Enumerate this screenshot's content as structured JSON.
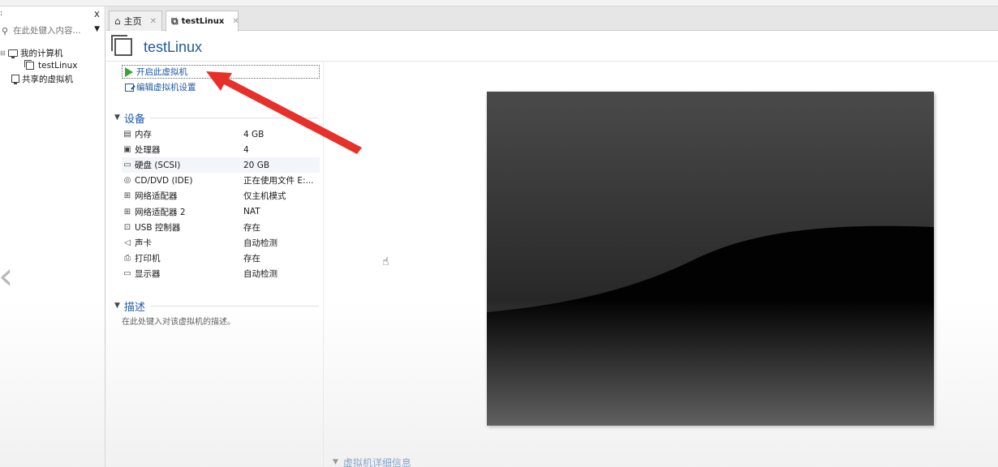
{
  "library": {
    "search_placeholder": "在此处键入内容...",
    "close_glyph": "x",
    "tree": {
      "my_computer": "我的计算机",
      "vm": "testLinux",
      "shared": "共享的虚拟机"
    }
  },
  "tabs": [
    {
      "label": "主页"
    },
    {
      "label": "testLinux"
    }
  ],
  "vm": {
    "name": "testLinux",
    "actions": {
      "power_on": "开启此虚拟机",
      "edit_settings": "编辑虚拟机设置"
    },
    "devices_title": "设备",
    "devices": [
      {
        "icon": "memory-icon",
        "name": "内存",
        "value": "4 GB"
      },
      {
        "icon": "cpu-icon",
        "name": "处理器",
        "value": "4"
      },
      {
        "icon": "hdd-icon",
        "name": "硬盘 (SCSI)",
        "value": "20 GB"
      },
      {
        "icon": "cd-icon",
        "name": "CD/DVD (IDE)",
        "value": "正在使用文件 E:..."
      },
      {
        "icon": "network-icon",
        "name": "网络适配器",
        "value": "仅主机模式"
      },
      {
        "icon": "network-icon",
        "name": "网络适配器 2",
        "value": "NAT"
      },
      {
        "icon": "usb-icon",
        "name": "USB 控制器",
        "value": "存在"
      },
      {
        "icon": "sound-icon",
        "name": "声卡",
        "value": "自动检测"
      },
      {
        "icon": "printer-icon",
        "name": "打印机",
        "value": "存在"
      },
      {
        "icon": "display-icon",
        "name": "显示器",
        "value": "自动检测"
      }
    ],
    "description_title": "描述",
    "description_placeholder": "在此处键入对该虚拟机的描述。",
    "details_title": "虚拟机详细信息"
  },
  "colors": {
    "link": "#1d58a6",
    "play": "#3aa334",
    "annotation_arrow": "#e8302a"
  }
}
